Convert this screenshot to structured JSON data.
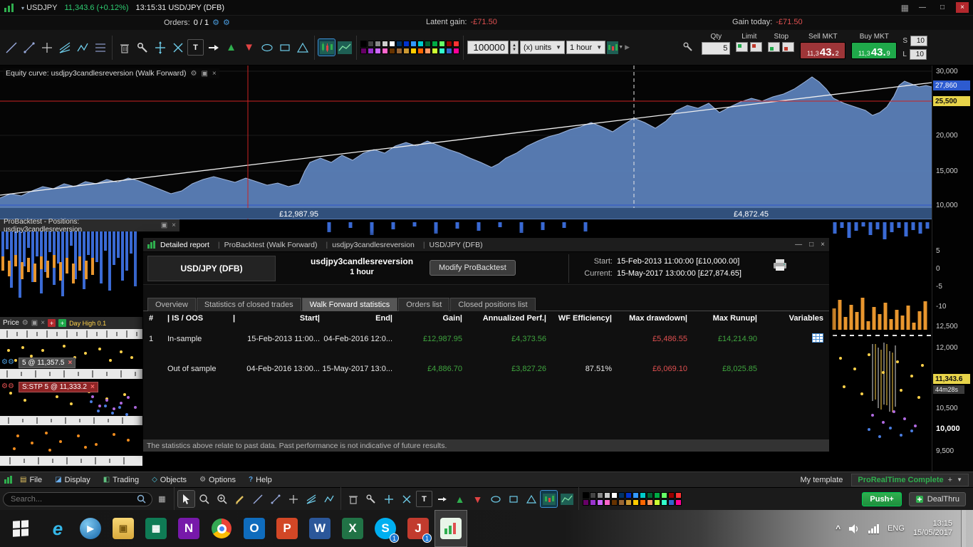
{
  "colors": {
    "accent-green": "#2fae4e",
    "buy-green": "#1fa94a",
    "sell-red": "#9e3538",
    "neg-red": "#e05050",
    "pos-green": "#3fa53f",
    "price-green": "#2ecc71",
    "tag-yellow": "#e8d44a",
    "tag-blue": "#2d5bd0",
    "equity-fill": "#5b7fb8",
    "bar-blue": "#3a6ad4",
    "bar-orange": "#e8962e"
  },
  "titlebar": {
    "symbol": "USDJPY",
    "price": "11,343.6 (+0.12%)",
    "clock": "13:15:31 USD/JPY (DFB)",
    "latent_gain_label": "Latent gain:",
    "latent_gain_value": "-£71.50",
    "gain_today_label": "Gain today:",
    "gain_today_value": "-£71.50"
  },
  "top_toolbar": {
    "orders_label": "Orders:",
    "orders_value": "0  /  1",
    "qty_input": "100000",
    "units_dropdown": "(x) units",
    "timeframe_dropdown": "1 hour",
    "trade": {
      "qty_label": "Qty",
      "qty_value": "5",
      "limit_label": "Limit",
      "stop_label": "Stop",
      "sell_label": "Sell MKT",
      "sell_price_prefix": "11,3",
      "sell_price_main": "43.",
      "sell_price_sup": "2",
      "buy_label": "Buy MKT",
      "buy_price_prefix": "11,3",
      "buy_price_main": "43.",
      "buy_price_sup": "9",
      "s_label": "S",
      "s_value": "10",
      "l_label": "L",
      "l_value": "10"
    }
  },
  "equity_pane": {
    "title": "Equity curve: usdjpy3candlesreversion (Walk Forward)",
    "in_sample_label": "£12,987.95",
    "oos_label": "£4,872.45"
  },
  "positions_pane": {
    "title": "ProBacktest - Positions: usdjpy3candlesreversion"
  },
  "price_pane": {
    "title": "Price",
    "day_high": "Day High 0.1",
    "position_badge": "5 @ 11,357.5",
    "order_badge": "S:STP 5 @ 11,333.2"
  },
  "right_axis": {
    "labels_equity": [
      "30,000",
      "20,000",
      "15,000",
      "10,000"
    ],
    "tag_equity_current": "27,860",
    "tag_equity_alert": "25,500",
    "labels_positions": [
      "5",
      "0",
      "-5",
      "-10"
    ],
    "labels_price": [
      "12,500",
      "12,000",
      "10,500",
      "10,000",
      "9,500"
    ],
    "tag_price_last": "11,343.6",
    "countdown": "44m28s"
  },
  "report": {
    "titlebar_tabs": [
      "Detailed report",
      "ProBacktest (Walk Forward)",
      "usdjpy3candlesreversion",
      "USD/JPY (DFB)"
    ],
    "instrument": "USD/JPY (DFB)",
    "strategy_name": "usdjpy3candlesreversion",
    "strategy_tf": "1 hour",
    "modify_button": "Modify ProBacktest",
    "start_label": "Start:",
    "start_value": "15-Feb-2013 11:00:00 [£10,000.00]",
    "current_label": "Current:",
    "current_value": "15-May-2017 13:00:00 [£27,874.65]",
    "tabs": [
      "Overview",
      "Statistics of closed trades",
      "Walk Forward statistics",
      "Orders list",
      "Closed positions list"
    ],
    "columns": [
      "#",
      "| IS / OOS",
      "|",
      "Start|",
      "End|",
      "Gain|",
      "Annualized Perf.|",
      "WF Efficiency|",
      "Max drawdown|",
      "Max Runup|",
      "Variables"
    ],
    "rows": [
      {
        "num": "1",
        "type": "In-sample",
        "start": "15-Feb-2013 11:00...",
        "end": "04-Feb-2016 12:0...",
        "gain": "£12,987.95",
        "annualized": "£4,373.56",
        "wf": "",
        "drawdown": "£5,486.55",
        "runup": "£14,214.90"
      },
      {
        "num": "",
        "type": "Out of sample",
        "start": "04-Feb-2016 13:00...",
        "end": "15-May-2017 13:0...",
        "gain": "£4,886.70",
        "annualized": "£3,827.26",
        "wf": "87.51%",
        "drawdown": "£6,069.10",
        "runup": "£8,025.85"
      }
    ],
    "disclaimer": "The statistics above relate to past data. Past performance is not indicative of future results."
  },
  "menubar": {
    "items": [
      "File",
      "Display",
      "Trading",
      "Objects",
      "Options",
      "Help"
    ],
    "my_template": "My template",
    "brand": "ProRealTime Complete"
  },
  "bottom_toolbar": {
    "search_placeholder": "Search...",
    "push_button": "Push+",
    "dealthru_button": "DealThru"
  },
  "palette_row1": [
    "#000000",
    "#444444",
    "#888888",
    "#cccccc",
    "#ffffff",
    "#003366",
    "#0033cc",
    "#3399ff",
    "#00cccc",
    "#006633",
    "#00aa44",
    "#66ff66",
    "#990000",
    "#ff3333"
  ],
  "palette_row2": [
    "#660066",
    "#9933cc",
    "#cc66ff",
    "#ff66cc",
    "#663300",
    "#996633",
    "#cc9933",
    "#ffcc00",
    "#ff6600",
    "#ff9966",
    "#ccff33",
    "#33ffcc",
    "#3366cc",
    "#ff0099"
  ],
  "taskbar": {
    "time": "13:15",
    "date": "15/05/2017",
    "language": "ENG",
    "icons": {
      "ie": "e",
      "wmp": "▶",
      "explorer": "▣",
      "appgreen": "▦",
      "onenote": "N",
      "outlook": "O",
      "powerpoint": "P",
      "word": "W",
      "excel": "X",
      "skype": "S",
      "appred": "J"
    },
    "badge_skype": "1",
    "badge_red": "1"
  }
}
